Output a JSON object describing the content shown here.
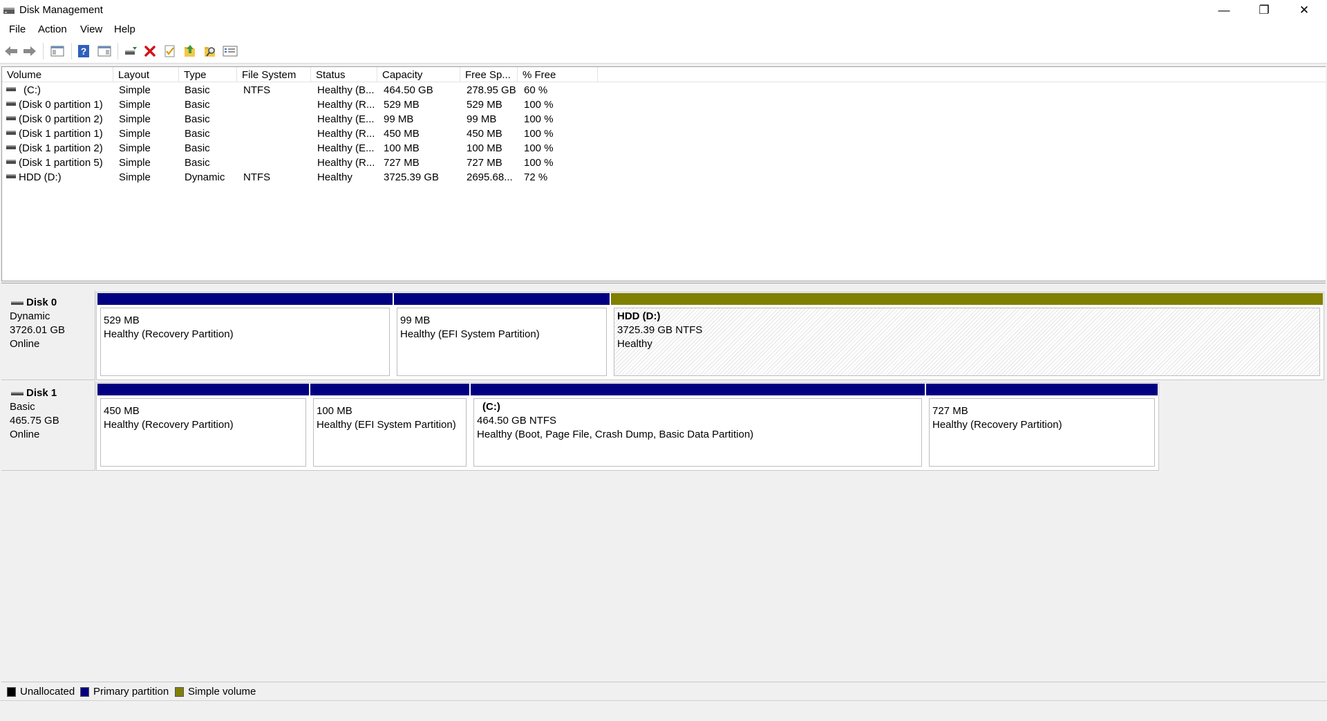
{
  "window": {
    "title": "Disk Management",
    "minimize_glyph": "—",
    "maximize_glyph": "❐",
    "close_glyph": "✕"
  },
  "menu": [
    "File",
    "Action",
    "View",
    "Help"
  ],
  "toolbar": {
    "icons": [
      "back-arrow-icon",
      "forward-arrow-icon",
      "show-hide-console-tree-icon",
      "help-icon",
      "show-hide-action-pane-icon",
      "connect-virtual-disk-icon",
      "delete-icon",
      "check-properties-icon",
      "up-folder-icon",
      "search-folder-icon",
      "settings-list-icon"
    ]
  },
  "columns": [
    "Volume",
    "Layout",
    "Type",
    "File System",
    "Status",
    "Capacity",
    "Free Sp...",
    "% Free"
  ],
  "volumes": [
    {
      "volume": "(C:)",
      "layout": "Simple",
      "type": "Basic",
      "fs": "NTFS",
      "status": "Healthy (B...",
      "capacity": "464.50 GB",
      "free": "278.95 GB",
      "pct": "60 %"
    },
    {
      "volume": "(Disk 0 partition 1)",
      "layout": "Simple",
      "type": "Basic",
      "fs": "",
      "status": "Healthy (R...",
      "capacity": "529 MB",
      "free": "529 MB",
      "pct": "100 %"
    },
    {
      "volume": "(Disk 0 partition 2)",
      "layout": "Simple",
      "type": "Basic",
      "fs": "",
      "status": "Healthy (E...",
      "capacity": "99 MB",
      "free": "99 MB",
      "pct": "100 %"
    },
    {
      "volume": "(Disk 1 partition 1)",
      "layout": "Simple",
      "type": "Basic",
      "fs": "",
      "status": "Healthy (R...",
      "capacity": "450 MB",
      "free": "450 MB",
      "pct": "100 %"
    },
    {
      "volume": "(Disk 1 partition 2)",
      "layout": "Simple",
      "type": "Basic",
      "fs": "",
      "status": "Healthy (E...",
      "capacity": "100 MB",
      "free": "100 MB",
      "pct": "100 %"
    },
    {
      "volume": "(Disk 1 partition 5)",
      "layout": "Simple",
      "type": "Basic",
      "fs": "",
      "status": "Healthy (R...",
      "capacity": "727 MB",
      "free": "727 MB",
      "pct": "100 %"
    },
    {
      "volume": "HDD (D:)",
      "layout": "Simple",
      "type": "Dynamic",
      "fs": "NTFS",
      "status": "Healthy",
      "capacity": "3725.39 GB",
      "free": "2695.68...",
      "pct": "72 %"
    }
  ],
  "disks": [
    {
      "name": "Disk 0",
      "kind": "Dynamic",
      "size": "3726.01 GB",
      "state": "Online",
      "partitions": [
        {
          "name": "",
          "line1": "529 MB",
          "line2": "Healthy (Recovery Partition)",
          "band_color": "#000080"
        },
        {
          "name": "",
          "line1": "99 MB",
          "line2": "Healthy (EFI System Partition)",
          "band_color": "#000080"
        },
        {
          "name": "HDD  (D:)",
          "line1": "3725.39 GB NTFS",
          "line2": "Healthy",
          "band_color": "#808000"
        }
      ]
    },
    {
      "name": "Disk 1",
      "kind": "Basic",
      "size": "465.75 GB",
      "state": "Online",
      "partitions": [
        {
          "name": "",
          "line1": "450 MB",
          "line2": "Healthy (Recovery Partition)",
          "band_color": "#000080"
        },
        {
          "name": "",
          "line1": "100 MB",
          "line2": "Healthy (EFI System Partition)",
          "band_color": "#000080"
        },
        {
          "name": "(C:)",
          "line1": "464.50 GB NTFS",
          "line2": "Healthy (Boot, Page File, Crash Dump, Basic Data Partition)",
          "band_color": "#000080"
        },
        {
          "name": "",
          "line1": "727 MB",
          "line2": "Healthy (Recovery Partition)",
          "band_color": "#000080"
        }
      ]
    }
  ],
  "legend": [
    {
      "label": "Unallocated",
      "color": "#000000"
    },
    {
      "label": "Primary partition",
      "color": "#000080"
    },
    {
      "label": "Simple volume",
      "color": "#808000"
    }
  ]
}
